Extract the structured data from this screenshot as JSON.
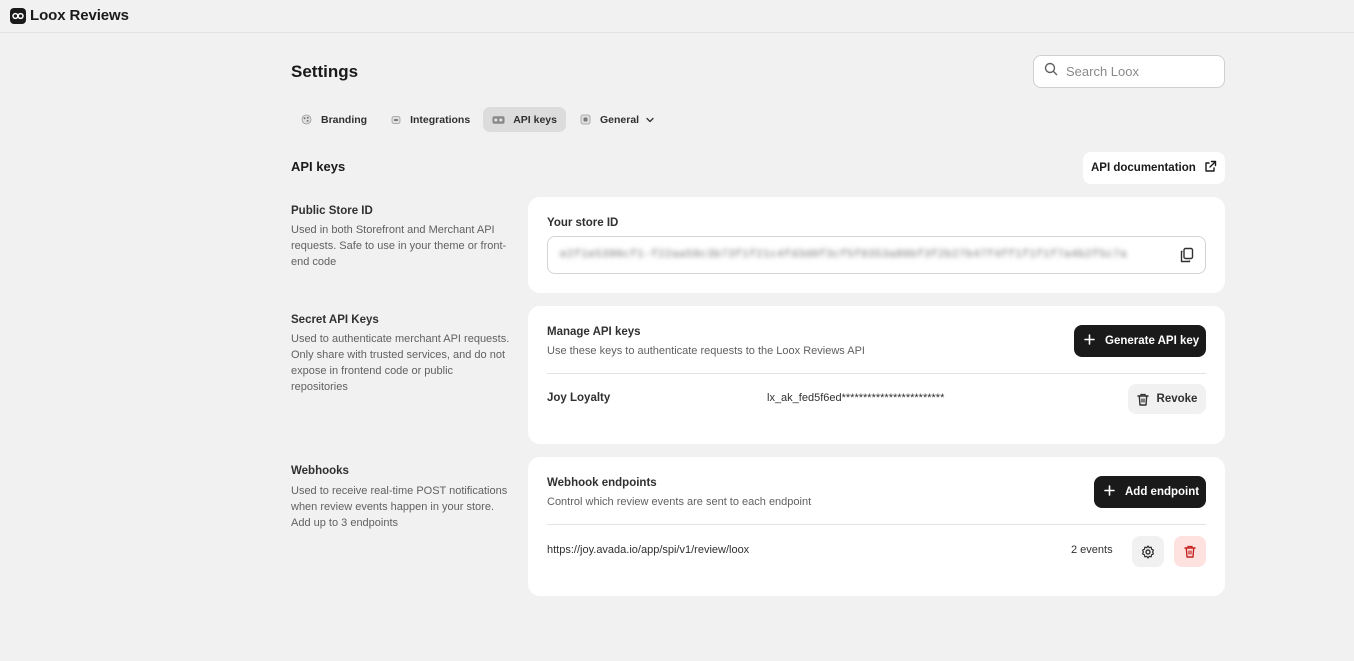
{
  "app": {
    "title": "Loox Reviews"
  },
  "page": {
    "title": "Settings"
  },
  "search": {
    "placeholder": "Search Loox"
  },
  "tabs": [
    {
      "label": "Branding",
      "icon": "branding-icon"
    },
    {
      "label": "Integrations",
      "icon": "integrations-icon"
    },
    {
      "label": "API keys",
      "icon": "api-keys-icon",
      "active": true
    },
    {
      "label": "General",
      "icon": "general-icon"
    }
  ],
  "api_section": {
    "title": "API keys",
    "doc_button": "API documentation"
  },
  "public_store": {
    "title": "Public Store ID",
    "desc": "Used in both Storefront and Merchant API requests. Safe to use in your theme or front-end code",
    "card_label": "Your store ID",
    "value": "e2f1e5390cf1-f22aa59c3b73f1f21c4fd3d0f3cf5f0353a80bf3f2b27b47f4ff1f1f1f7a4b2f5c7a"
  },
  "secret_keys": {
    "title": "Secret API Keys",
    "desc": "Used to authenticate merchant API requests. Only share with trusted services, and do not expose in frontend code or public repositories",
    "card_label": "Manage API keys",
    "card_sub": "Use these keys to authenticate requests to the Loox Reviews API",
    "generate_button": "Generate API key",
    "keys": [
      {
        "name": "Joy Loyalty",
        "key": "lx_ak_fed5f6ed************************",
        "revoke_label": "Revoke"
      }
    ]
  },
  "webhooks": {
    "title": "Webhooks",
    "desc": "Used to receive real-time POST notifications when review events happen in your store. Add up to 3 endpoints",
    "card_label": "Webhook endpoints",
    "card_sub": "Control which review events are sent to each endpoint",
    "add_button": "Add endpoint",
    "endpoints": [
      {
        "url": "https://joy.avada.io/app/spi/v1/review/loox",
        "events": "2 events"
      }
    ]
  },
  "colors": {
    "accent_dark": "#1a1a1a",
    "danger_bg": "#fde2e0",
    "danger_icon": "#c5221f",
    "page_bg": "#f1f1f1"
  }
}
